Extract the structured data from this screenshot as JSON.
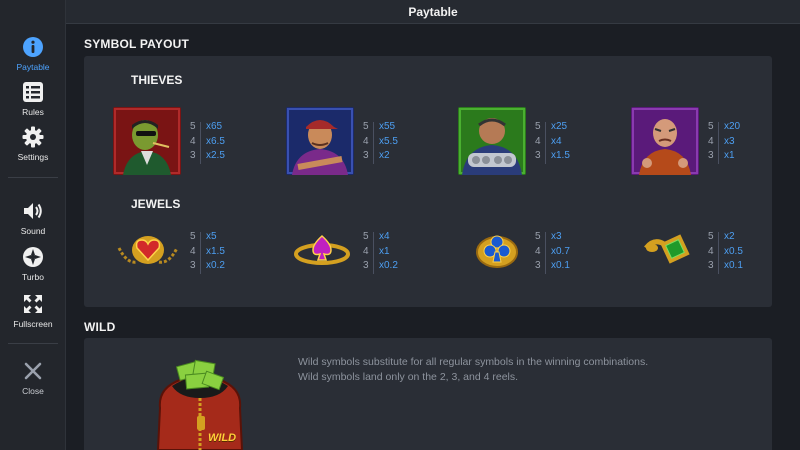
{
  "header": {
    "title": "Paytable"
  },
  "sidebar": {
    "items": [
      {
        "label": "Paytable",
        "icon": "info-icon"
      },
      {
        "label": "Rules",
        "icon": "list-icon"
      },
      {
        "label": "Settings",
        "icon": "gear-icon"
      },
      {
        "label": "Sound",
        "icon": "speaker-icon"
      },
      {
        "label": "Turbo",
        "icon": "turbo-icon"
      },
      {
        "label": "Fullscreen",
        "icon": "fullscreen-icon"
      },
      {
        "label": "Close",
        "icon": "close-icon"
      }
    ],
    "active_color": "#4da3ff"
  },
  "symbol_payout": {
    "title": "SYMBOL PAYOUT",
    "thieves": {
      "title": "THIEVES",
      "symbols": [
        {
          "name": "sunglasses-thief",
          "payouts": [
            [
              "5",
              "x65"
            ],
            [
              "4",
              "x6.5"
            ],
            [
              "3",
              "x2.5"
            ]
          ]
        },
        {
          "name": "cap-thief",
          "payouts": [
            [
              "5",
              "x55"
            ],
            [
              "4",
              "x5.5"
            ],
            [
              "3",
              "x2"
            ]
          ]
        },
        {
          "name": "bruiser-thief",
          "payouts": [
            [
              "5",
              "x25"
            ],
            [
              "4",
              "x4"
            ],
            [
              "3",
              "x1.5"
            ]
          ]
        },
        {
          "name": "bald-thief",
          "payouts": [
            [
              "5",
              "x20"
            ],
            [
              "4",
              "x3"
            ],
            [
              "3",
              "x1"
            ]
          ]
        }
      ]
    },
    "jewels": {
      "title": "JEWELS",
      "symbols": [
        {
          "name": "heart-ring",
          "payouts": [
            [
              "5",
              "x5"
            ],
            [
              "4",
              "x1.5"
            ],
            [
              "3",
              "x0.2"
            ]
          ]
        },
        {
          "name": "spade-ring",
          "payouts": [
            [
              "5",
              "x4"
            ],
            [
              "4",
              "x1"
            ],
            [
              "3",
              "x0.2"
            ]
          ]
        },
        {
          "name": "club-ring",
          "payouts": [
            [
              "5",
              "x3"
            ],
            [
              "4",
              "x0.7"
            ],
            [
              "3",
              "x0.1"
            ]
          ]
        },
        {
          "name": "emerald-ring",
          "payouts": [
            [
              "5",
              "x2"
            ],
            [
              "4",
              "x0.5"
            ],
            [
              "3",
              "x0.1"
            ]
          ]
        }
      ]
    }
  },
  "wild": {
    "title": "WILD",
    "description_line1": "Wild symbols substitute for all regular symbols in the winning combinations.",
    "description_line2": "Wild symbols land only on the 2, 3, and 4 reels.",
    "badge": "WILD"
  },
  "colors": {
    "payout_value": "#4d9ff2",
    "payout_count": "#9aa1ad",
    "panel_bg": "#2a2e36",
    "page_bg": "#1b1e24"
  }
}
